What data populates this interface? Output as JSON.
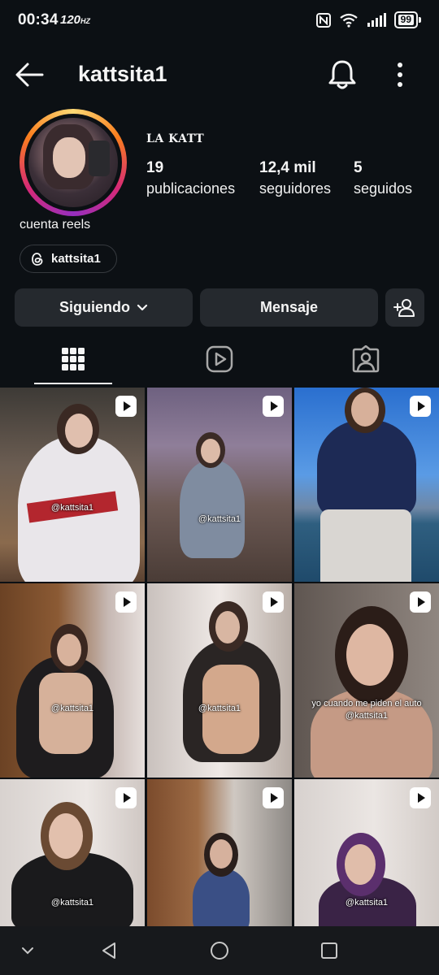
{
  "status": {
    "time": "00:34",
    "refresh_rate": "120",
    "refresh_unit": "HZ",
    "battery": "99",
    "icons": [
      "nfc-icon",
      "wifi-icon",
      "signal-icon",
      "battery-icon"
    ]
  },
  "header": {
    "username": "kattsita1",
    "icons": [
      "back-arrow-icon",
      "bell-icon",
      "more-vertical-icon"
    ]
  },
  "profile": {
    "display_name": "LA KATT",
    "bio": "cuenta reels",
    "threads_handle": "kattsita1",
    "stats": [
      {
        "value": "19",
        "label": "publicaciones"
      },
      {
        "value": "12,4 mil",
        "label": "seguidores"
      },
      {
        "value": "5",
        "label": "seguidos"
      }
    ]
  },
  "actions": {
    "following_label": "Siguiendo",
    "message_label": "Mensaje",
    "icons": [
      "chevron-down-icon",
      "add-person-icon"
    ]
  },
  "tabs": [
    {
      "name": "posts",
      "icon": "grid-icon",
      "active": true
    },
    {
      "name": "reels",
      "icon": "reels-icon",
      "active": false
    },
    {
      "name": "tagged",
      "icon": "tagged-icon",
      "active": false
    }
  ],
  "posts": [
    {
      "caption": "@kattsita1",
      "type": "reel"
    },
    {
      "caption": "@kattsita1",
      "type": "reel"
    },
    {
      "caption": "",
      "type": "reel"
    },
    {
      "caption": "@kattsita1",
      "type": "reel"
    },
    {
      "caption": "@kattsita1",
      "type": "reel"
    },
    {
      "caption": "yo cuando me piden el auto",
      "caption2": "@kattsita1",
      "type": "reel"
    },
    {
      "caption": "@kattsita1",
      "type": "reel"
    },
    {
      "caption": "",
      "type": "reel"
    },
    {
      "caption": "@kattsita1",
      "type": "reel"
    }
  ],
  "navbar": {
    "icons": [
      "chevron-down-nav-icon",
      "back-triangle-icon",
      "home-circle-icon",
      "recents-square-icon"
    ]
  },
  "colors": {
    "background": "#0c1014",
    "button": "#25292e",
    "text": "#f5f5f5"
  }
}
